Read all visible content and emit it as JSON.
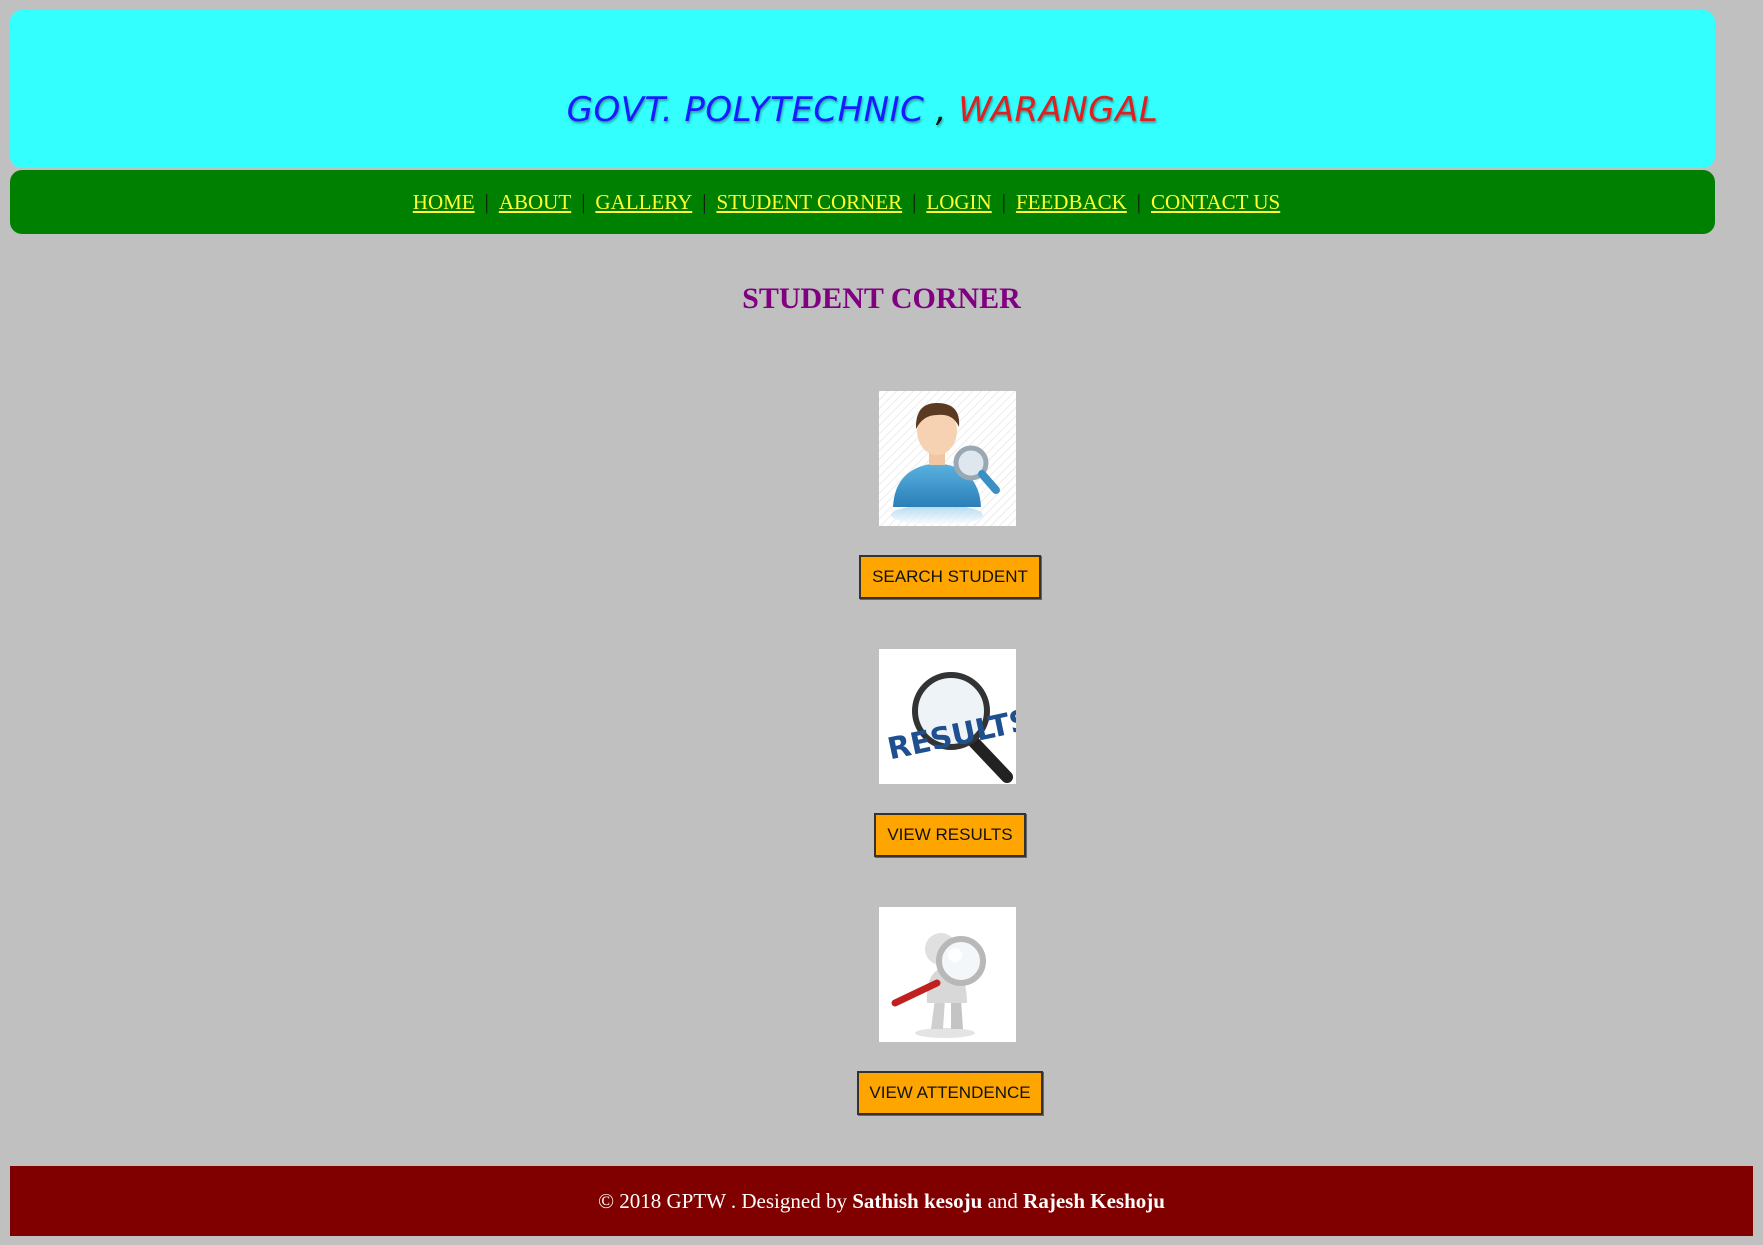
{
  "header": {
    "title_part1": "GOVT. POLYTECHNIC",
    "title_sep": " , ",
    "title_part2": "WARANGAL"
  },
  "nav": {
    "items": [
      {
        "label": "HOME "
      },
      {
        "label": "ABOUT "
      },
      {
        "label": "GALLERY"
      },
      {
        "label": "STUDENT CORNER"
      },
      {
        "label": "LOGIN"
      },
      {
        "label": "FEEDBACK"
      },
      {
        "label": "CONTACT US"
      }
    ],
    "separator": "|"
  },
  "main": {
    "title": "STUDENT CORNER",
    "tiles": [
      {
        "button_label": "SEARCH STUDENT",
        "icon": "person-search-icon"
      },
      {
        "button_label": "VIEW RESULTS",
        "icon": "results-magnifier-icon",
        "image_text": "RESULTS"
      },
      {
        "button_label": "VIEW ATTENDENCE",
        "icon": "figure-magnifier-icon"
      }
    ]
  },
  "footer": {
    "prefix": "© 2018 GPTW . Designed by ",
    "designer1": "Sathish kesoju",
    "and": " and ",
    "designer2": "Rajesh Keshoju"
  },
  "colors": {
    "background": "#c0c0c0",
    "header_bg": "#33ffff",
    "nav_bg": "#008000",
    "nav_link": "#ffff33",
    "title": "#800080",
    "button_bg": "#ffa500",
    "footer_bg": "#800000"
  }
}
